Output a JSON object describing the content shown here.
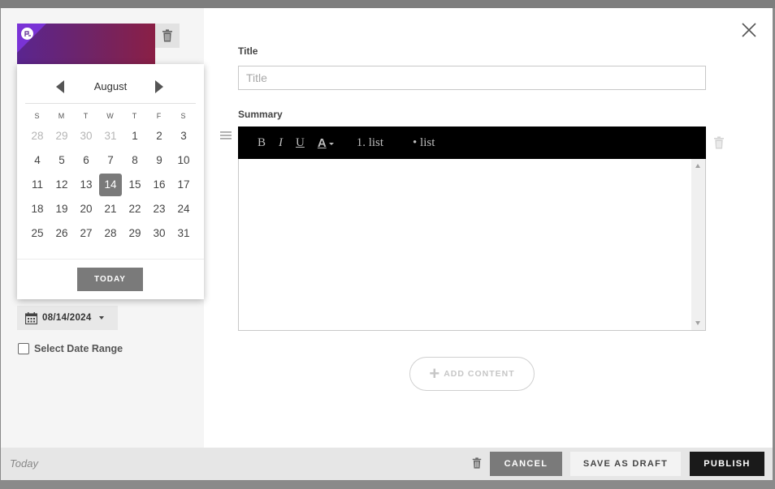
{
  "left": {
    "thumbnail": {
      "gradient_colors": [
        "#5a2590",
        "#8a1f45"
      ],
      "corner_color": "#7a33d6",
      "badge_icon": "brand-badge-icon"
    },
    "delete_icon": "trash-icon",
    "calendar": {
      "month": "August",
      "weekdays": [
        "S",
        "M",
        "T",
        "W",
        "T",
        "F",
        "S"
      ],
      "weeks": [
        [
          {
            "d": "28",
            "m": true
          },
          {
            "d": "29",
            "m": true
          },
          {
            "d": "30",
            "m": true
          },
          {
            "d": "31",
            "m": true
          },
          {
            "d": "1"
          },
          {
            "d": "2"
          },
          {
            "d": "3"
          }
        ],
        [
          {
            "d": "4"
          },
          {
            "d": "5"
          },
          {
            "d": "6"
          },
          {
            "d": "7"
          },
          {
            "d": "8"
          },
          {
            "d": "9"
          },
          {
            "d": "10"
          }
        ],
        [
          {
            "d": "11"
          },
          {
            "d": "12"
          },
          {
            "d": "13"
          },
          {
            "d": "14",
            "s": true
          },
          {
            "d": "15"
          },
          {
            "d": "16"
          },
          {
            "d": "17"
          }
        ],
        [
          {
            "d": "18"
          },
          {
            "d": "19"
          },
          {
            "d": "20"
          },
          {
            "d": "21"
          },
          {
            "d": "22"
          },
          {
            "d": "23"
          },
          {
            "d": "24"
          }
        ],
        [
          {
            "d": "25"
          },
          {
            "d": "26"
          },
          {
            "d": "27"
          },
          {
            "d": "28"
          },
          {
            "d": "29"
          },
          {
            "d": "30"
          },
          {
            "d": "31"
          }
        ]
      ],
      "today_label": "TODAY",
      "selected_color": "#7a7a7a"
    },
    "date_value": "08/14/2024",
    "range_label": "Select Date Range",
    "range_checked": false
  },
  "main": {
    "title_label": "Title",
    "title_placeholder": "Title",
    "title_value": "",
    "summary_label": "Summary",
    "toolbar": {
      "bold": "B",
      "italic": "I",
      "underline": "U",
      "color": "A",
      "ordered_list": "1. list",
      "bullet_list": "• list"
    },
    "add_content_label": "ADD CONTENT"
  },
  "footer": {
    "today": "Today",
    "cancel": "CANCEL",
    "save_draft": "SAVE AS DRAFT",
    "publish": "PUBLISH"
  }
}
